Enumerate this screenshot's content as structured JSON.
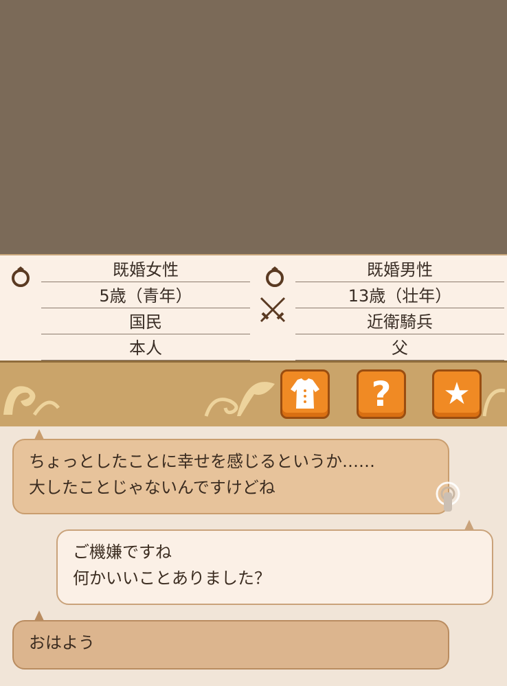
{
  "music_icon": "♪",
  "left_profile": {
    "marital": "既婚女性",
    "age": "5歳（青年）",
    "class": "国民",
    "relation": "本人"
  },
  "right_profile": {
    "marital": "既婚男性",
    "age": "13歳（壮年）",
    "class": "近衛騎兵",
    "relation": "父"
  },
  "toolbar": {
    "clothes_icon": "clothes-icon",
    "help_label": "?",
    "favorite_label": "★"
  },
  "chat": [
    {
      "speaker": "npc",
      "line1": "ちょっとしたことに幸せを感じるというか……",
      "line2": "大したことじゃないんですけどね"
    },
    {
      "speaker": "player",
      "line1": "ご機嫌ですね",
      "line2": "何かいいことありました？"
    },
    {
      "speaker": "npc",
      "line1": "おはよう"
    }
  ],
  "colors": {
    "portrait_bg": "#a9d4c3",
    "toolbar_bg": "#caa46a",
    "button_orange": "#f08a24",
    "npc_bubble": "#e7c39b",
    "player_bubble": "#fbf0e6"
  }
}
